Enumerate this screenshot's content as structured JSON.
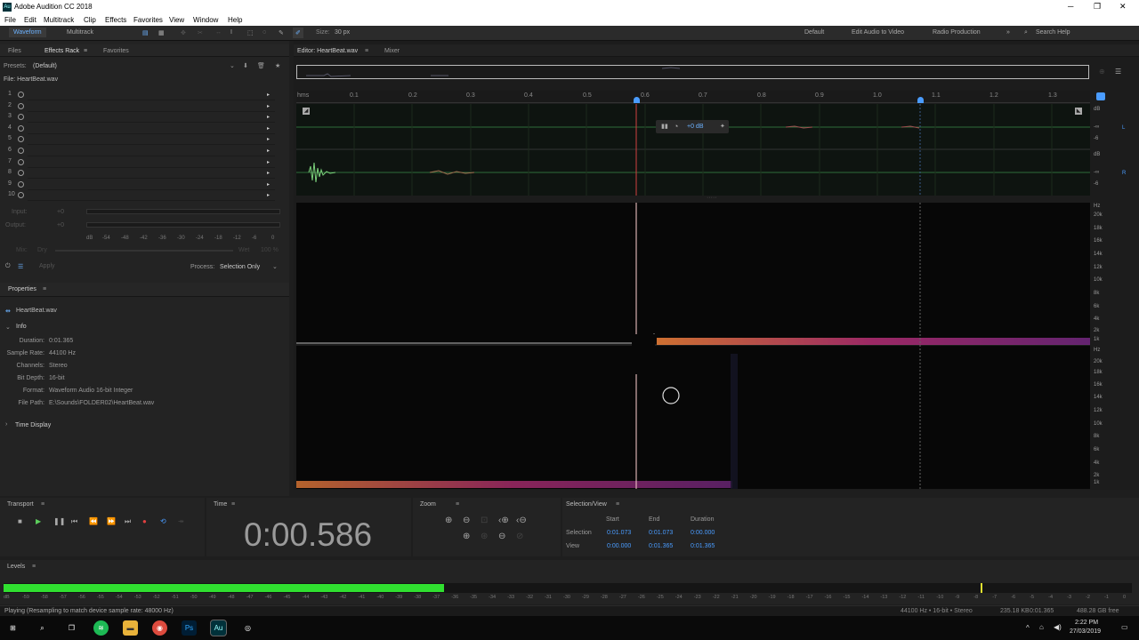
{
  "window": {
    "title": "Adobe Audition CC 2018"
  },
  "menu": [
    "File",
    "Edit",
    "Multitrack",
    "Clip",
    "Effects",
    "Favorites",
    "View",
    "Window",
    "Help"
  ],
  "toolbar": {
    "waveform": "Waveform",
    "multitrack": "Multitrack",
    "size_label": "Size:",
    "size_value": "30 px",
    "workspaces": [
      "Default",
      "Edit Audio to Video",
      "Radio Production"
    ],
    "search_placeholder": "Search Help"
  },
  "left": {
    "tabs": [
      "Files",
      "Effects Rack",
      "Favorites"
    ],
    "presets_label": "Presets:",
    "presets_value": "(Default)",
    "file_label": "File: HeartBeat.wav",
    "slots": [
      "1",
      "2",
      "3",
      "4",
      "5",
      "6",
      "7",
      "8",
      "9",
      "10"
    ],
    "input_label": "Input:",
    "output_label": "Output:",
    "input_db": "+0",
    "output_db": "+0",
    "meter_ticks": [
      "dB",
      "-54",
      "-48",
      "-42",
      "-36",
      "-30",
      "-24",
      "-18",
      "-12",
      "-6",
      "0"
    ],
    "mix_label": "Mix:",
    "dry_label": "Dry",
    "wet_label": "Wet",
    "wet_value": "100 %",
    "apply": "Apply",
    "process_label": "Process:",
    "process_value": "Selection Only"
  },
  "properties": {
    "title": "Properties",
    "file": "HeartBeat.wav",
    "info_title": "Info",
    "rows": [
      {
        "k": "Duration:",
        "v": "0:01.365"
      },
      {
        "k": "Sample Rate:",
        "v": "44100 Hz"
      },
      {
        "k": "Channels:",
        "v": "Stereo"
      },
      {
        "k": "Bit Depth:",
        "v": "16-bit"
      },
      {
        "k": "Format:",
        "v": "Waveform Audio 16-bit Integer"
      },
      {
        "k": "File Path:",
        "v": "E:\\Sounds\\FOLDER02\\HeartBeat.wav"
      }
    ],
    "time_display": "Time Display"
  },
  "editor": {
    "tab": "Editor: HeartBeat.wav",
    "mixer": "Mixer",
    "ruler": [
      "hms",
      "0.1",
      "0.2",
      "0.3",
      "0.4",
      "0.5",
      "0.6",
      "0.7",
      "0.8",
      "0.9",
      "1.0",
      "1.1",
      "1.2",
      "1.3"
    ],
    "hud_db": "+0 dB",
    "db_scale": [
      "dB",
      "-∞",
      "-6",
      "dB",
      "-∞",
      "-6"
    ],
    "hz_scale": [
      "Hz",
      "20k",
      "18k",
      "16k",
      "14k",
      "12k",
      "10k",
      "8k",
      "6k",
      "4k",
      "2k",
      "1k",
      "Hz",
      "20k",
      "18k",
      "16k",
      "14k",
      "12k",
      "10k",
      "8k",
      "6k",
      "4k",
      "2k",
      "1k"
    ],
    "ch_labels": [
      "L",
      "R"
    ]
  },
  "transport": {
    "title": "Transport"
  },
  "time": {
    "title": "Time",
    "value": "0:00.586"
  },
  "zoom": {
    "title": "Zoom"
  },
  "selection": {
    "title": "Selection/View",
    "headers": [
      "Start",
      "End",
      "Duration"
    ],
    "rows": [
      {
        "label": "Selection",
        "start": "0:01.073",
        "end": "0:01.073",
        "dur": "0:00.000"
      },
      {
        "label": "View",
        "start": "0:00.000",
        "end": "0:01.365",
        "dur": "0:01.365"
      }
    ]
  },
  "levels": {
    "title": "Levels",
    "ticks": [
      "dB",
      "-59",
      "-58",
      "-57",
      "-56",
      "-55",
      "-54",
      "-53",
      "-52",
      "-51",
      "-50",
      "-49",
      "-48",
      "-47",
      "-46",
      "-45",
      "-44",
      "-43",
      "-42",
      "-41",
      "-40",
      "-39",
      "-38",
      "-37",
      "-36",
      "-35",
      "-34",
      "-33",
      "-32",
      "-31",
      "-30",
      "-29",
      "-28",
      "-27",
      "-26",
      "-25",
      "-24",
      "-23",
      "-22",
      "-21",
      "-20",
      "-19",
      "-18",
      "-17",
      "-16",
      "-15",
      "-14",
      "-13",
      "-12",
      "-11",
      "-10",
      "-9",
      "-8",
      "-7",
      "-6",
      "-5",
      "-4",
      "-3",
      "-2",
      "-1",
      "0"
    ],
    "fill_fraction": 0.39
  },
  "status": {
    "left": "Playing (Resampling to match device sample rate: 48000 Hz)",
    "items": [
      "44100 Hz • 16-bit • Stereo",
      "235.18 KB",
      "0:01.365",
      "488.28 GB free"
    ]
  },
  "taskbar": {
    "time": "2:22 PM",
    "date": "27/03/2019"
  }
}
